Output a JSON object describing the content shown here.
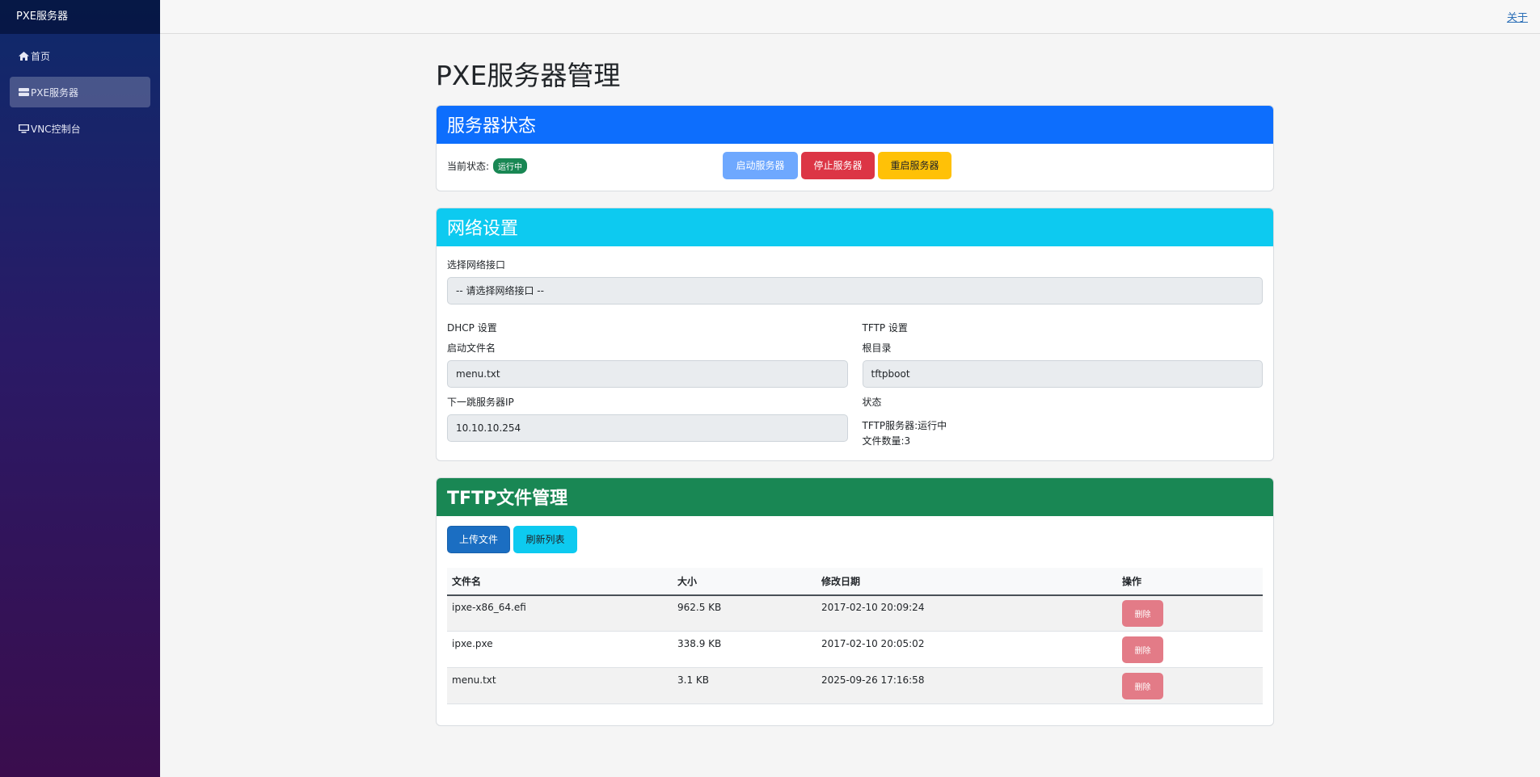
{
  "app": {
    "brand": "PXE服务器"
  },
  "sidebar": {
    "items": [
      {
        "label": "首页",
        "icon": "home-icon",
        "active": false
      },
      {
        "label": "PXE服务器",
        "icon": "server-icon",
        "active": true
      },
      {
        "label": "VNC控制台",
        "icon": "monitor-icon",
        "active": false
      }
    ]
  },
  "topbar": {
    "about_label": "关于"
  },
  "page": {
    "title": "PXE服务器管理"
  },
  "server_status": {
    "header": "服务器状态",
    "current_label": "当前状态:",
    "badge": "运行中",
    "start_label": "启动服务器",
    "stop_label": "停止服务器",
    "restart_label": "重启服务器"
  },
  "network": {
    "header": "网络设置",
    "iface_label": "选择网络接口",
    "iface_value": "-- 请选择网络接口 --",
    "dhcp_title": "DHCP 设置",
    "bootfile_label": "启动文件名",
    "bootfile_value": "menu.txt",
    "nextserver_label": "下一跳服务器IP",
    "nextserver_value": "10.10.10.254",
    "tftp_title": "TFTP 设置",
    "root_label": "根目录",
    "root_value": "tftpboot",
    "state_label": "状态",
    "tftp_status": "TFTP服务器:运行中",
    "file_count": "文件数量:3"
  },
  "tftp": {
    "header": "TFTP文件管理",
    "upload_label": "上传文件",
    "refresh_label": "刷新列表",
    "columns": [
      "文件名",
      "大小",
      "修改日期",
      "操作"
    ],
    "delete_label": "删除",
    "rows": [
      {
        "name": "ipxe-x86_64.efi",
        "size": "962.5 KB",
        "date": "2017-02-10 20:09:24"
      },
      {
        "name": "ipxe.pxe",
        "size": "338.9 KB",
        "date": "2017-02-10 20:05:02"
      },
      {
        "name": "menu.txt",
        "size": "3.1 KB",
        "date": "2025-09-26 17:16:58"
      }
    ]
  },
  "colors": {
    "primary": "#0d6efd",
    "info": "#0dcaf0",
    "success": "#198754",
    "danger": "#dc3545",
    "warning": "#ffc107"
  }
}
